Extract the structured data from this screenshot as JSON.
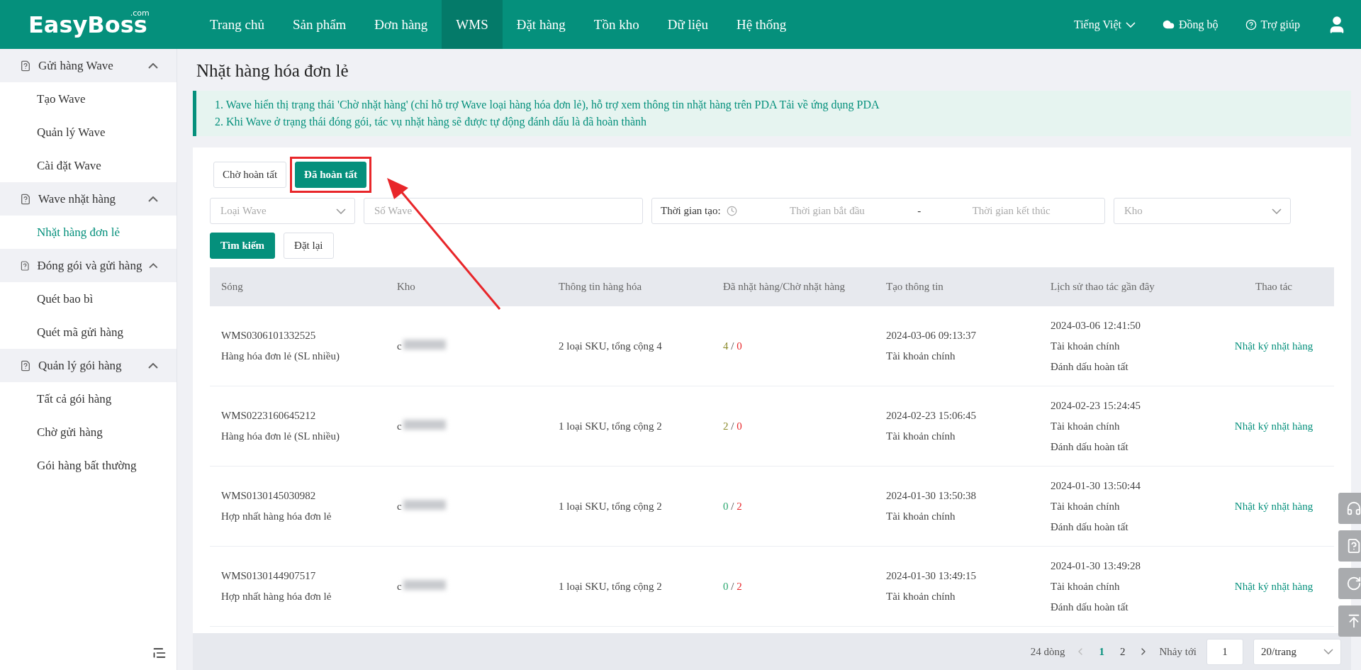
{
  "header": {
    "logo": "EasyBoss",
    "logo_suffix": ".com",
    "nav": [
      {
        "label": "Trang chủ",
        "selected": false
      },
      {
        "label": "Sản phẩm",
        "selected": false
      },
      {
        "label": "Đơn hàng",
        "selected": false
      },
      {
        "label": "WMS",
        "selected": true
      },
      {
        "label": "Đặt hàng",
        "selected": false
      },
      {
        "label": "Tồn kho",
        "selected": false
      },
      {
        "label": "Dữ liệu",
        "selected": false
      },
      {
        "label": "Hệ thống",
        "selected": false
      }
    ],
    "language": "Tiếng Việt",
    "sync": "Đồng bộ",
    "help": "Trợ giúp"
  },
  "sidebar": {
    "groups": [
      {
        "label": "Gửi hàng Wave",
        "expanded": true,
        "items": [
          {
            "label": "Tạo Wave",
            "selected": false
          },
          {
            "label": "Quản lý Wave",
            "selected": false
          },
          {
            "label": "Cài đặt Wave",
            "selected": false
          }
        ]
      },
      {
        "label": "Wave nhặt hàng",
        "expanded": true,
        "items": [
          {
            "label": "Nhặt hàng đơn lẻ",
            "selected": true
          }
        ]
      },
      {
        "label": "Đóng gói và gửi hàng",
        "expanded": true,
        "items": [
          {
            "label": "Quét bao bì",
            "selected": false
          },
          {
            "label": "Quét mã gửi hàng",
            "selected": false
          }
        ]
      },
      {
        "label": "Quản lý gói hàng",
        "expanded": true,
        "items": [
          {
            "label": "Tất cả gói hàng",
            "selected": false
          },
          {
            "label": "Chờ gửi hàng",
            "selected": false
          },
          {
            "label": "Gói hàng bất thường",
            "selected": false
          }
        ]
      }
    ]
  },
  "page_title": "Nhặt hàng hóa đơn lẻ",
  "notice": {
    "line_1": "1. Wave hiển thị trạng thái 'Chờ nhặt hàng' (chỉ hỗ trợ Wave loại hàng hóa đơn lẻ), hỗ trợ xem thông tin nhặt hàng trên PDA",
    "link": "Tải về ứng dụng PDA",
    "line_2": "2. Khi Wave ở trạng thái đóng gói, tác vụ nhặt hàng sẽ được tự động đánh dấu là đã hoàn thành"
  },
  "tabs": [
    {
      "label": "Chờ hoàn tất",
      "selected": false
    },
    {
      "label": "Đã hoàn tất",
      "selected": true
    }
  ],
  "filters": {
    "wave_type": {
      "placeholder": "Loại Wave"
    },
    "wave_no": {
      "placeholder": "Số Wave"
    },
    "created_label": "Thời gian tạo:",
    "start": {
      "placeholder": "Thời gian bắt đầu"
    },
    "separator": "-",
    "end": {
      "placeholder": "Thời gian kết thúc"
    },
    "warehouse": {
      "placeholder": "Kho"
    },
    "search_button": "Tìm kiếm",
    "reset_button": "Đặt lại"
  },
  "table": {
    "count_separator": "/",
    "columns": [
      "Sóng",
      "Kho",
      "Thông tin hàng hóa",
      "Đã nhặt hàng/Chờ nhặt hàng",
      "Tạo thông tin",
      "Lịch sử thao tác gần đây",
      "Thao tác"
    ],
    "rows": [
      {
        "wave": "WMS0306101332525",
        "wave_type": "Hàng hóa đơn lẻ (SL nhiều)",
        "warehouse": "c",
        "goods": "2 loại SKU, tổng cộng 4",
        "picked": "4",
        "pending": "0",
        "created_time": "2024-03-06 09:13:37",
        "created_by": "Tài khoản chính",
        "history_time": "2024-03-06 12:41:50",
        "history_by": "Tài khoản chính",
        "history_action": "Đánh dấu hoàn tất",
        "action": "Nhật ký nhặt hàng"
      },
      {
        "wave": "WMS0223160645212",
        "wave_type": "Hàng hóa đơn lẻ (SL nhiều)",
        "warehouse": "c",
        "goods": "1 loại SKU, tổng cộng 2",
        "picked": "2",
        "pending": "0",
        "created_time": "2024-02-23 15:06:45",
        "created_by": "Tài khoản chính",
        "history_time": "2024-02-23 15:24:45",
        "history_by": "Tài khoản chính",
        "history_action": "Đánh dấu hoàn tất",
        "action": "Nhật ký nhặt hàng"
      },
      {
        "wave": "WMS0130145030982",
        "wave_type": "Hợp nhất hàng hóa đơn lẻ",
        "warehouse": "c",
        "goods": "1 loại SKU, tổng cộng 2",
        "picked": "0",
        "pending": "2",
        "created_time": "2024-01-30 13:50:38",
        "created_by": "Tài khoản chính",
        "history_time": "2024-01-30 13:50:44",
        "history_by": "Tài khoản chính",
        "history_action": "Đánh dấu hoàn tất",
        "action": "Nhật ký nhặt hàng"
      },
      {
        "wave": "WMS0130144907517",
        "wave_type": "Hợp nhất hàng hóa đơn lẻ",
        "warehouse": "c",
        "goods": "1 loại SKU, tổng cộng 2",
        "picked": "0",
        "pending": "2",
        "created_time": "2024-01-30 13:49:15",
        "created_by": "Tài khoản chính",
        "history_time": "2024-01-30 13:49:28",
        "history_by": "Tài khoản chính",
        "history_action": "Đánh dấu hoàn tất",
        "action": "Nhật ký nhặt hàng"
      }
    ]
  },
  "pagination": {
    "total": "24 dòng",
    "pages": [
      {
        "label": "1",
        "selected": true
      },
      {
        "label": "2",
        "selected": false
      }
    ],
    "jump_label": "Nhảy tới",
    "jump_value": "1",
    "page_size": "20/trang"
  }
}
